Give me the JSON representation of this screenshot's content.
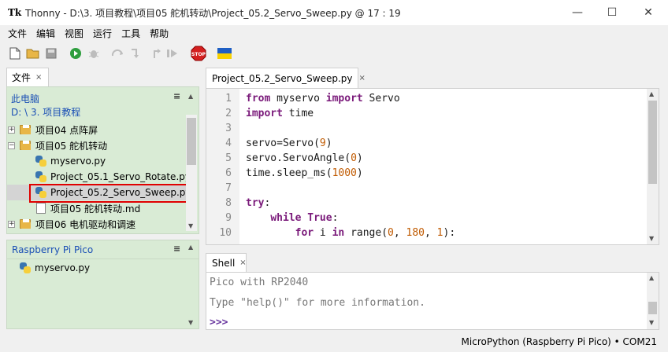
{
  "window": {
    "title": "Thonny  -  D:\\3. 项目教程\\项目05 舵机转动\\Project_05.2_Servo_Sweep.py  @  17 : 19",
    "app_icon": "Tk"
  },
  "menu": [
    "文件",
    "编辑",
    "视图",
    "运行",
    "工具",
    "帮助"
  ],
  "toolbar": {
    "icons": [
      "new-file-icon",
      "open-folder-icon",
      "save-icon",
      "run-icon",
      "debug-icon",
      "step-over-icon",
      "step-into-icon",
      "step-out-icon",
      "resume-icon",
      "stop-icon",
      "ukraine-flag-icon"
    ],
    "stop_label": "STOP"
  },
  "files": {
    "tab_label": "文件",
    "close": "×",
    "menu_glyph": "≡",
    "computer_label": "此电脑",
    "path": "D: \\ 3. 项目教程",
    "tree": [
      {
        "label": "项目04 点阵屏",
        "type": "folder",
        "expander": "+"
      },
      {
        "label": "项目05 舵机转动",
        "type": "folder",
        "expander": "−"
      },
      {
        "label": "myservo.py",
        "type": "python"
      },
      {
        "label": "Project_05.1_Servo_Rotate.py",
        "type": "python"
      },
      {
        "label": "Project_05.2_Servo_Sweep.py",
        "type": "python",
        "selected": true
      },
      {
        "label": "项目05 舵机转动.md",
        "type": "markdown"
      },
      {
        "label": "项目06 电机驱动和调速",
        "type": "folder",
        "expander": "+"
      }
    ]
  },
  "device": {
    "header": "Raspberry Pi Pico",
    "menu_glyph": "≡",
    "files": [
      "myservo.py"
    ]
  },
  "editor": {
    "tab_label": "Project_05.2_Servo_Sweep.py",
    "close": "×",
    "line_numbers": [
      "1",
      "2",
      "3",
      "4",
      "5",
      "6",
      "7",
      "8",
      "9",
      "10"
    ],
    "lines": [
      {
        "kw1": "from",
        "t1": " myservo ",
        "kw2": "import",
        "t2": " Servo"
      },
      {
        "kw1": "import",
        "t1": " time"
      },
      {},
      {
        "t1": "servo=Servo(",
        "n1": "9",
        "t2": ")"
      },
      {
        "t1": "servo.ServoAngle(",
        "n1": "0",
        "t2": ")"
      },
      {
        "t1": "time.sleep_ms(",
        "n1": "1000",
        "t2": ")"
      },
      {},
      {
        "kw1": "try",
        "t1": ":"
      },
      {
        "t0": "    ",
        "kw1": "while",
        "t1": " ",
        "kw2": "True",
        "t2": ":"
      },
      {
        "t0": "        ",
        "kw1": "for",
        "t1": " i ",
        "kw2": "in",
        "t2": " range(",
        "n1": "0",
        "t3": ", ",
        "n2": "180",
        "t4": ", ",
        "n3": "1",
        "t5": "):"
      }
    ]
  },
  "shell": {
    "tab_label": "Shell",
    "close": "×",
    "lines": [
      "Pico with RP2040",
      "Type \"help()\" for more information."
    ],
    "prompt": ">>>"
  },
  "status": {
    "interpreter": "MicroPython (Raspberry Pi Pico)  •  COM21"
  }
}
